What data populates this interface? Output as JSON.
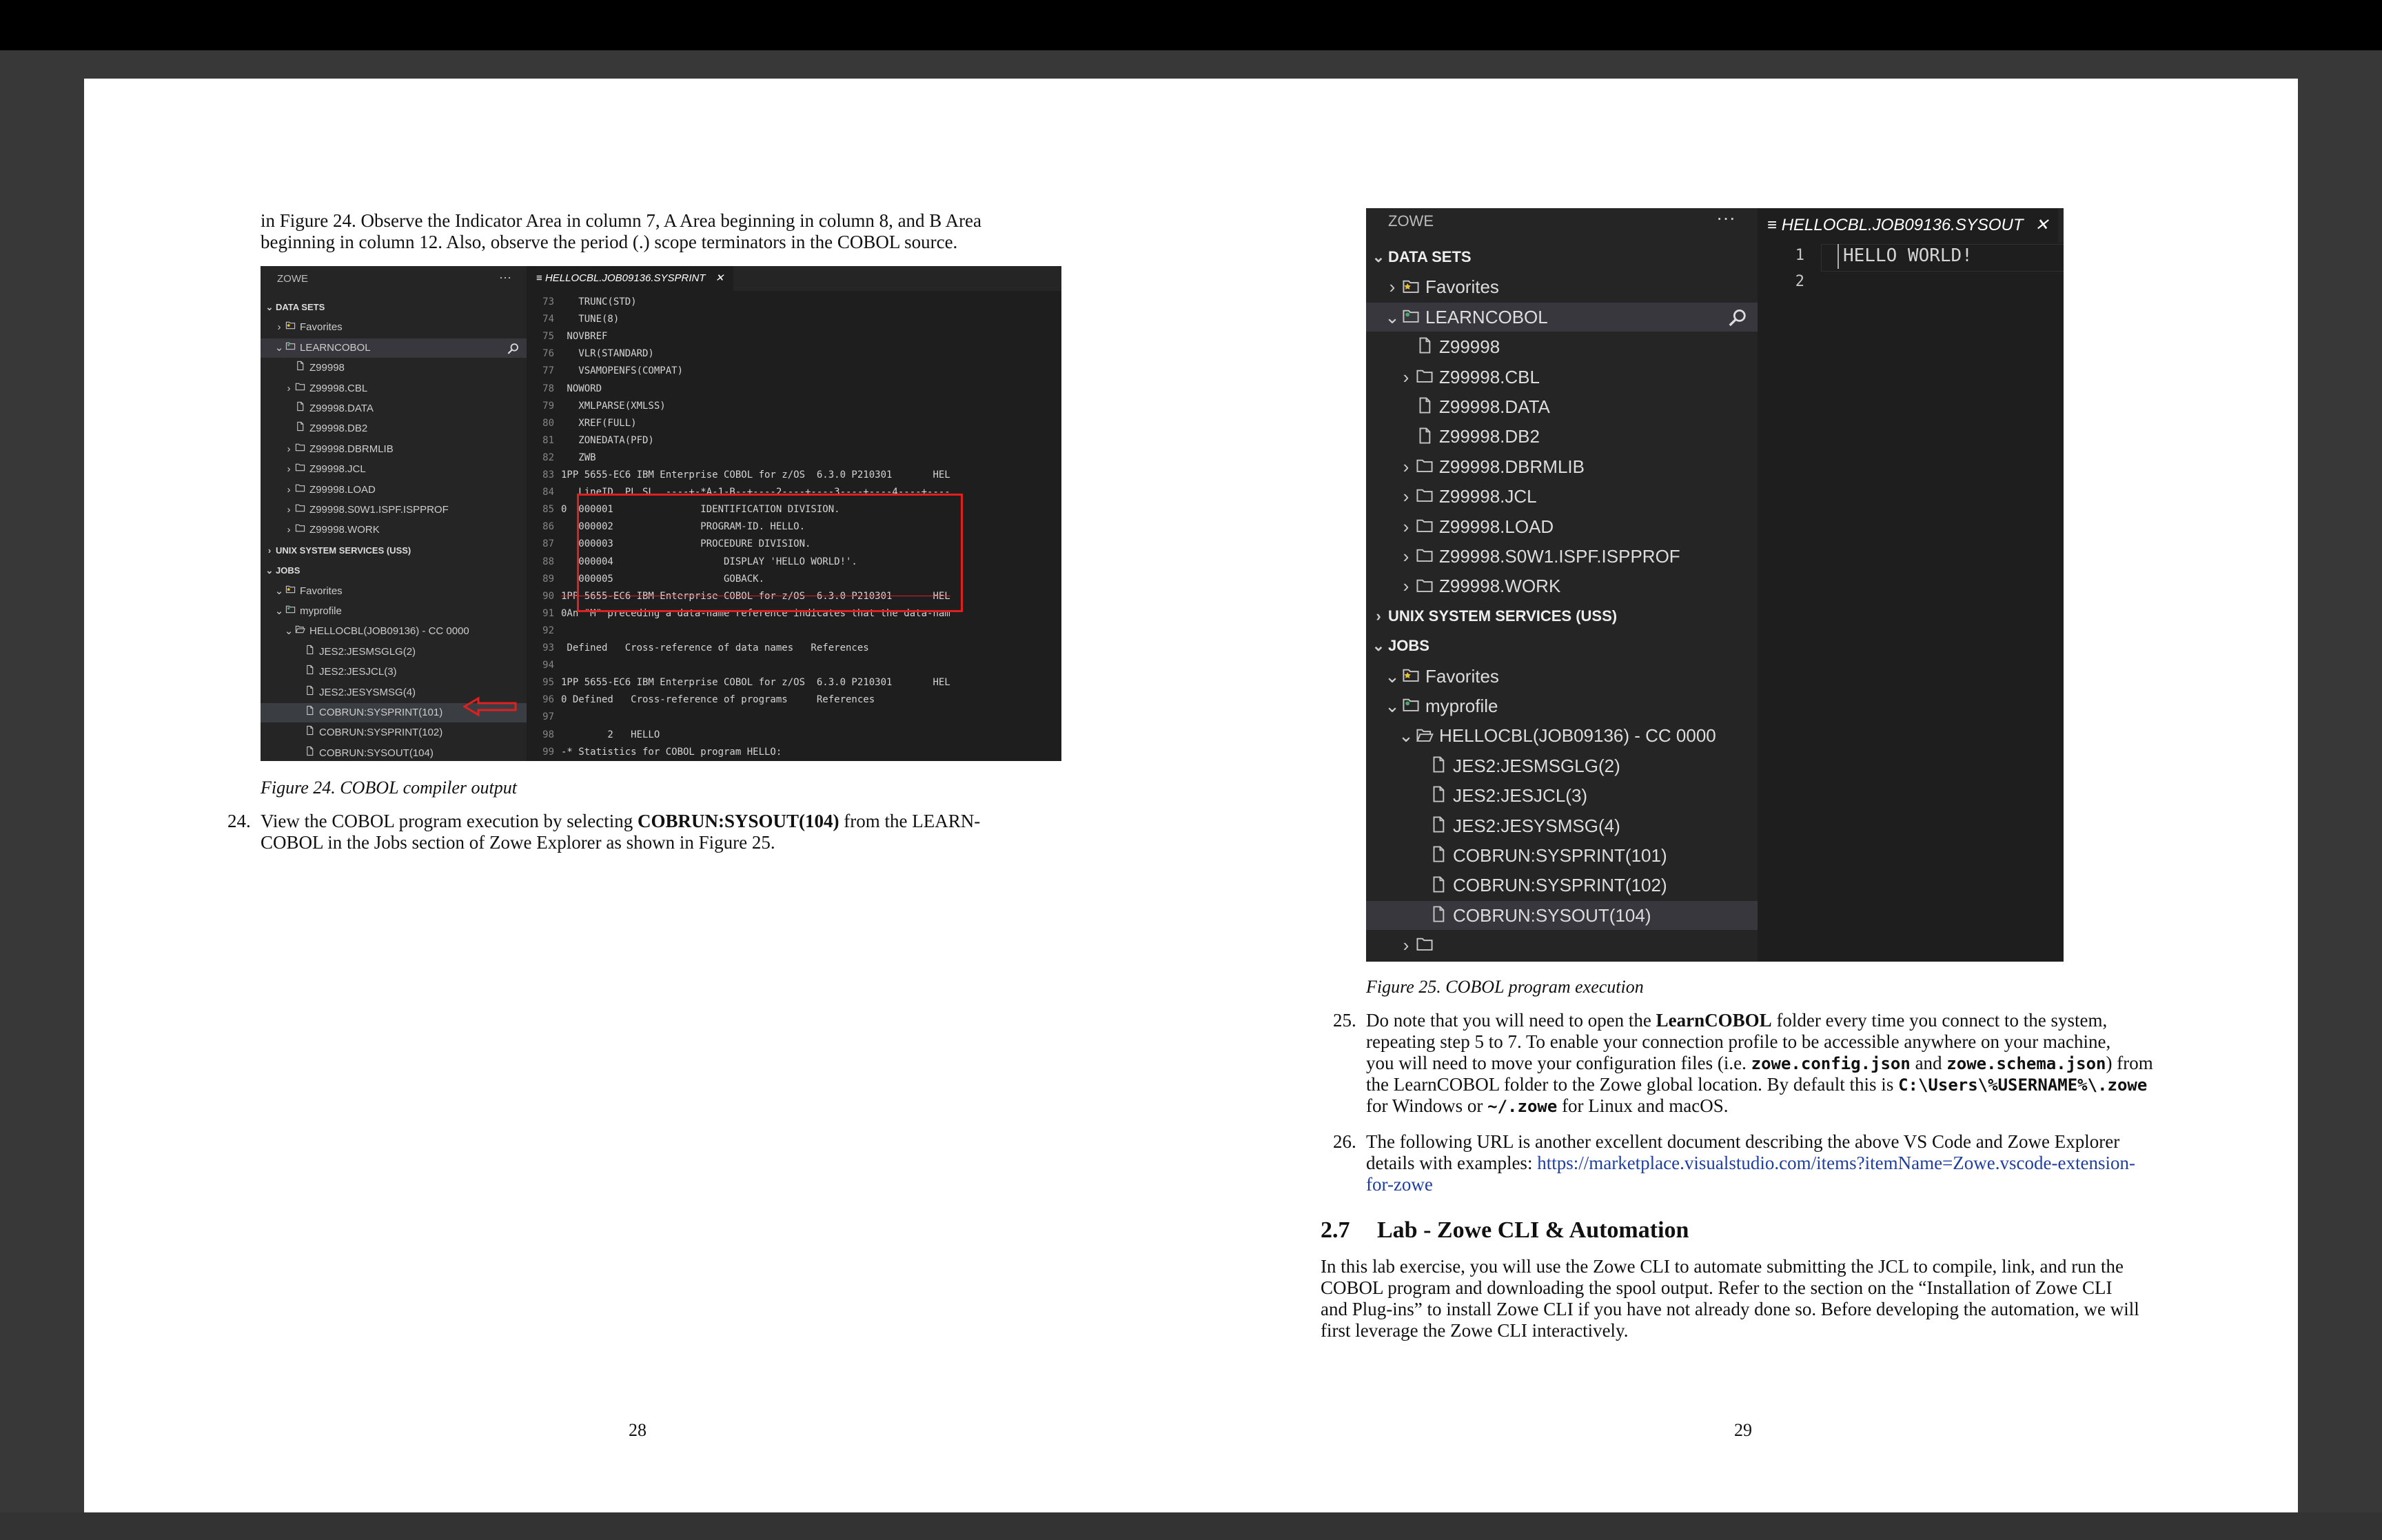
{
  "left_page": {
    "intro_line1": "in Figure 24.  Observe the Indicator Area in column 7, A Area beginning in column 8, and B Area",
    "intro_line2": "beginning in column 12.  Also, observe the period (.) scope terminators in the COBOL source.",
    "fig24_caption": "Figure 24. COBOL compiler output",
    "step24_num": "24.",
    "step24_pre": "View the COBOL program execution by selecting ",
    "step24_bold": "COBRUN:SYSOUT(104)",
    "step24_post": " from the LEARN-",
    "step24_line2": "COBOL in the Jobs section of Zowe Explorer as shown in Figure 25.",
    "page_number": "28"
  },
  "fig24": {
    "panel_title": "ZOWE",
    "more": "···",
    "tab_label": "HELLOCBL.JOB09136.SYSPRINT",
    "tab_close": "✕",
    "tree": [
      {
        "label": "DATA SETS",
        "chev": "⌄",
        "header": true
      },
      {
        "label": "Favorites",
        "chev": "›",
        "icon": "star-folder"
      },
      {
        "label": "LEARNCOBOL",
        "chev": "⌄",
        "icon": "profile-folder",
        "selected": true
      },
      {
        "label": "Z99998",
        "icon": "file"
      },
      {
        "label": "Z99998.CBL",
        "chev": "›",
        "icon": "folder"
      },
      {
        "label": "Z99998.DATA",
        "icon": "file"
      },
      {
        "label": "Z99998.DB2",
        "icon": "file"
      },
      {
        "label": "Z99998.DBRMLIB",
        "chev": "›",
        "icon": "folder"
      },
      {
        "label": "Z99998.JCL",
        "chev": "›",
        "icon": "folder"
      },
      {
        "label": "Z99998.LOAD",
        "chev": "›",
        "icon": "folder"
      },
      {
        "label": "Z99998.S0W1.ISPF.ISPPROF",
        "chev": "›",
        "icon": "folder"
      },
      {
        "label": "Z99998.WORK",
        "chev": "›",
        "icon": "folder"
      },
      {
        "label": "UNIX SYSTEM SERVICES (USS)",
        "chev": "›",
        "header": true
      },
      {
        "label": "JOBS",
        "chev": "⌄",
        "header": true
      },
      {
        "label": "Favorites",
        "chev": "⌄",
        "icon": "star-folder"
      },
      {
        "label": "myprofile",
        "chev": "⌄",
        "icon": "profile-folder"
      },
      {
        "label": "HELLOCBL(JOB09136) - CC 0000",
        "chev": "⌄",
        "icon": "open-folder"
      },
      {
        "label": "JES2:JESMSGLG(2)",
        "icon": "file"
      },
      {
        "label": "JES2:JESJCL(3)",
        "icon": "file"
      },
      {
        "label": "JES2:JESYSMSG(4)",
        "icon": "file"
      },
      {
        "label": "COBRUN:SYSPRINT(101)",
        "icon": "file",
        "highlight": true
      },
      {
        "label": "COBRUN:SYSPRINT(102)",
        "icon": "file"
      },
      {
        "label": "COBRUN:SYSOUT(104)",
        "icon": "file"
      }
    ],
    "code": [
      {
        "ln": "73",
        "text": "   TRUNC(STD)"
      },
      {
        "ln": "74",
        "text": "   TUNE(8)"
      },
      {
        "ln": "75",
        "text": " NOVBREF"
      },
      {
        "ln": "76",
        "text": "   VLR(STANDARD)"
      },
      {
        "ln": "77",
        "text": "   VSAMOPENFS(COMPAT)"
      },
      {
        "ln": "78",
        "text": " NOWORD"
      },
      {
        "ln": "79",
        "text": "   XMLPARSE(XMLSS)"
      },
      {
        "ln": "80",
        "text": "   XREF(FULL)"
      },
      {
        "ln": "81",
        "text": "   ZONEDATA(PFD)"
      },
      {
        "ln": "82",
        "text": "   ZWB"
      },
      {
        "ln": "83",
        "text": "1PP 5655-EC6 IBM Enterprise COBOL for z/OS  6.3.0 P210301       HEL"
      },
      {
        "ln": "84",
        "text": "   LineID  PL SL  ----+-*A-1-B--+----2----+----3----+----4----+----"
      },
      {
        "ln": "85",
        "text": "0  000001               IDENTIFICATION DIVISION."
      },
      {
        "ln": "86",
        "text": "   000002               PROGRAM-ID. HELLO."
      },
      {
        "ln": "87",
        "text": "   000003               PROCEDURE DIVISION."
      },
      {
        "ln": "88",
        "text": "   000004                   DISPLAY 'HELLO WORLD!'."
      },
      {
        "ln": "89",
        "text": "   000005                   GOBACK."
      },
      {
        "ln": "90",
        "text": "1PP 5655-EC6 IBM Enterprise COBOL for z/OS  6.3.0 P210301       HEL"
      },
      {
        "ln": "91",
        "text": "0An \"M\" preceding a data-name reference indicates that the data-nam"
      },
      {
        "ln": "92",
        "text": ""
      },
      {
        "ln": "93",
        "text": " Defined   Cross-reference of data names   References"
      },
      {
        "ln": "94",
        "text": ""
      },
      {
        "ln": "95",
        "text": "1PP 5655-EC6 IBM Enterprise COBOL for z/OS  6.3.0 P210301       HEL"
      },
      {
        "ln": "96",
        "text": "0 Defined   Cross-reference of programs     References"
      },
      {
        "ln": "97",
        "text": ""
      },
      {
        "ln": "98",
        "text": "        2   HELLO"
      },
      {
        "ln": "99",
        "text": "-* Statistics for COBOL program HELLO:"
      }
    ]
  },
  "fig25": {
    "panel_title": "ZOWE",
    "more": "···",
    "tab_label": "HELLOCBL.JOB09136.SYSOUT",
    "tab_close": "✕",
    "tree": [
      {
        "label": "DATA SETS",
        "chev": "⌄",
        "header": true
      },
      {
        "label": "Favorites",
        "chev": "›",
        "icon": "star-folder"
      },
      {
        "label": "LEARNCOBOL",
        "chev": "⌄",
        "icon": "profile-folder",
        "selected": true
      },
      {
        "label": "Z99998",
        "icon": "file"
      },
      {
        "label": "Z99998.CBL",
        "chev": "›",
        "icon": "folder"
      },
      {
        "label": "Z99998.DATA",
        "icon": "file"
      },
      {
        "label": "Z99998.DB2",
        "icon": "file"
      },
      {
        "label": "Z99998.DBRMLIB",
        "chev": "›",
        "icon": "folder"
      },
      {
        "label": "Z99998.JCL",
        "chev": "›",
        "icon": "folder"
      },
      {
        "label": "Z99998.LOAD",
        "chev": "›",
        "icon": "folder"
      },
      {
        "label": "Z99998.S0W1.ISPF.ISPPROF",
        "chev": "›",
        "icon": "folder"
      },
      {
        "label": "Z99998.WORK",
        "chev": "›",
        "icon": "folder"
      },
      {
        "label": "UNIX SYSTEM SERVICES (USS)",
        "chev": "›",
        "header": true
      },
      {
        "label": "JOBS",
        "chev": "⌄",
        "header": true
      },
      {
        "label": "Favorites",
        "chev": "⌄",
        "icon": "star-folder"
      },
      {
        "label": "myprofile",
        "chev": "⌄",
        "icon": "profile-folder"
      },
      {
        "label": "HELLOCBL(JOB09136) - CC 0000",
        "chev": "⌄",
        "icon": "open-folder"
      },
      {
        "label": "JES2:JESMSGLG(2)",
        "icon": "file"
      },
      {
        "label": "JES2:JESJCL(3)",
        "icon": "file"
      },
      {
        "label": "JES2:JESYSMSG(4)",
        "icon": "file"
      },
      {
        "label": "COBRUN:SYSPRINT(101)",
        "icon": "file"
      },
      {
        "label": "COBRUN:SYSPRINT(102)",
        "icon": "file"
      },
      {
        "label": "COBRUN:SYSOUT(104)",
        "icon": "file",
        "selected": true
      },
      {
        "label": "",
        "chev": "›",
        "icon": "folder"
      }
    ],
    "code": [
      {
        "ln": "1",
        "text": "HELLO WORLD!"
      },
      {
        "ln": "2",
        "text": ""
      }
    ]
  },
  "right_page": {
    "fig25_caption": "Figure 25. COBOL program execution",
    "step25_num": "25.",
    "step25_l1_pre": "Do note that you will need to open the ",
    "step25_l1_bold": "LearnCOBOL",
    "step25_l1_post": " folder every time you connect to the system,",
    "step25_l2": "repeating step 5 to 7.  To enable your connection profile to be accessible anywhere on your machine,",
    "step25_l3_pre": "you will need to move your configuration files (i.e. ",
    "step25_l3_code1": "zowe.config.json",
    "step25_l3_mid": " and ",
    "step25_l3_code2": "zowe.schema.json",
    "step25_l3_post": ") from",
    "step25_l4_pre": "the LearnCOBOL folder to the Zowe global location. By default this is ",
    "step25_l4_code": "C:\\Users\\%USERNAME%\\.zowe",
    "step25_l5_pre": "for Windows or ",
    "step25_l5_code": "~/.zowe",
    "step25_l5_post": " for Linux and macOS.",
    "step26_num": "26.",
    "step26_l1": "The following URL is another excellent document describing the above VS Code and Zowe Explorer",
    "step26_l2_pre": "details with examples: ",
    "step26_link1": "https://marketplace.visualstudio.com/items?itemName=Zowe.vscode-extension-",
    "step26_link2": "for-zowe",
    "section_number": "2.7",
    "section_title": "Lab - Zowe CLI & Automation",
    "para_l1": "In this lab exercise, you will use the Zowe CLI to automate submitting the JCL to compile, link, and run the",
    "para_l2": "COBOL program and downloading the spool output.  Refer to the section on the “Installation of Zowe CLI",
    "para_l3": "and Plug-ins” to install Zowe CLI if you have not already done so.  Before developing the automation, we will",
    "para_l4": "first leverage the Zowe CLI interactively.",
    "page_number": "29"
  },
  "colors": {
    "page_bg": "#383838",
    "editor_bg": "#1e1e1e",
    "sidebar_bg": "#252526",
    "annotation_red": "#e02020",
    "link_blue": "#1f3fa0"
  }
}
